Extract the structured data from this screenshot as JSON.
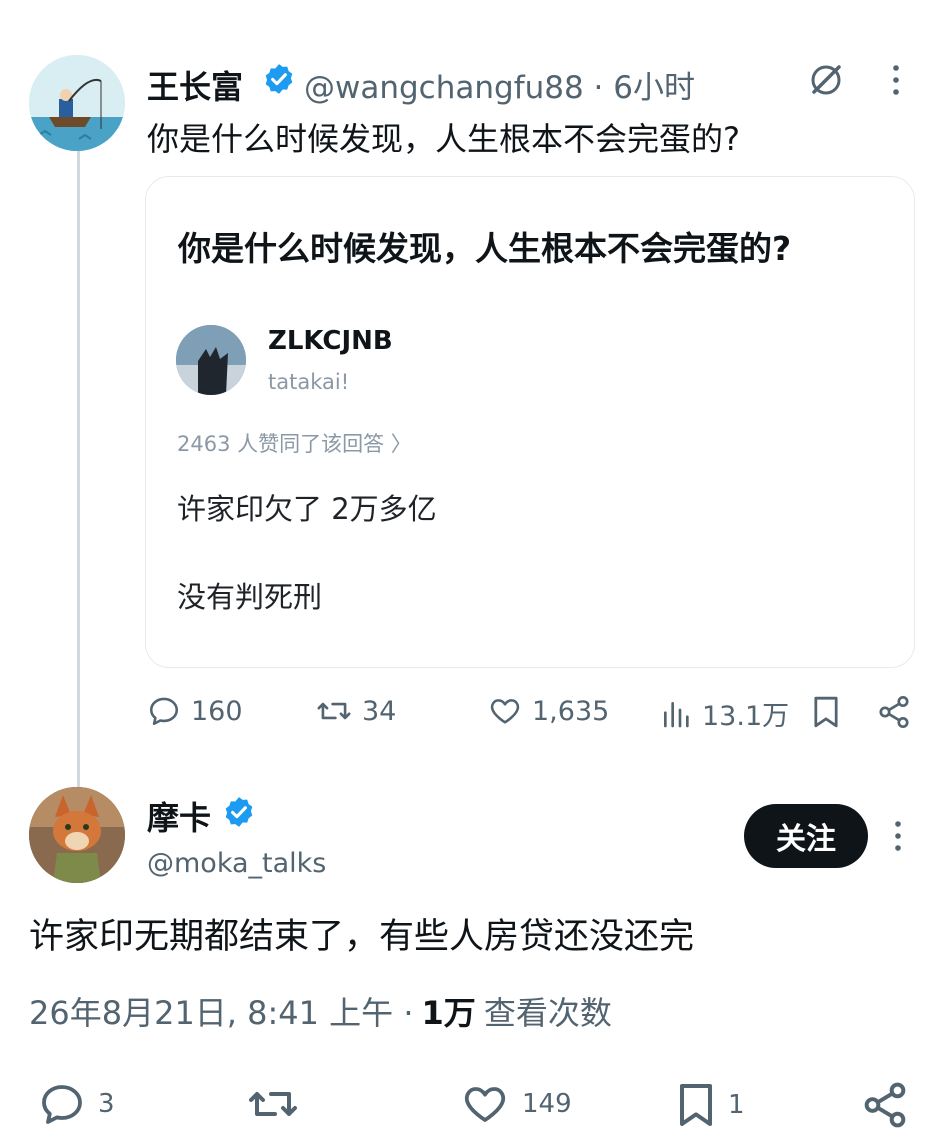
{
  "post1": {
    "author_name": "王长富",
    "handle_time": "@wangchangfu88 · 6小时",
    "text": "你是什么时候发现，人生根本不会完蛋的?",
    "quote": {
      "title": "你是什么时候发现，人生根本不会完蛋的?",
      "answerer_name": "ZLKCJNB",
      "answerer_bio": "tatakai!",
      "agree_text": "2463 人赞同了该回答 〉",
      "line1": "许家印欠了 2万多亿",
      "line2": "没有判死刑"
    },
    "actions": {
      "replies": "160",
      "reposts": "34",
      "likes": "1,635",
      "views": "13.1万"
    },
    "icons": [
      "verified-badge-icon",
      "grok-icon",
      "more-icon",
      "reply-icon",
      "repost-icon",
      "like-icon",
      "views-icon",
      "bookmark-icon",
      "share-icon"
    ]
  },
  "post2": {
    "author_name": "摩卡",
    "handle": "@moka_talks",
    "follow_label": "关注",
    "text": "许家印无期都结束了，有些人房贷还没还完",
    "timestamp": "26年8月21日, 8:41 上午 ·",
    "views_count": "1万",
    "views_label": "查看次数",
    "actions": {
      "replies": "3",
      "likes": "149",
      "bookmarks": "1"
    }
  },
  "colors": {
    "verified": "#1d9bf0",
    "text": "#0f1419",
    "muted": "#536471",
    "thread_line": "#cfd9de"
  }
}
